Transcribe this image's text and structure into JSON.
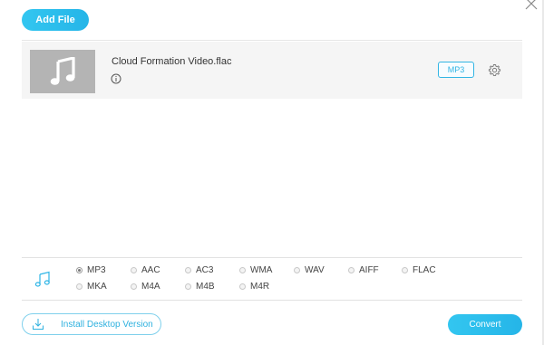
{
  "toolbar": {
    "add_file_label": "Add File"
  },
  "file": {
    "name": "Cloud Formation Video.flac",
    "output_format": "MP3"
  },
  "formats": {
    "selected": "MP3",
    "row1": [
      "MP3",
      "AAC",
      "AC3",
      "WMA",
      "WAV",
      "AIFF",
      "FLAC"
    ],
    "row2": [
      "MKA",
      "M4A",
      "M4B",
      "M4R"
    ]
  },
  "footer": {
    "install_label": "Install Desktop Version",
    "convert_label": "Convert"
  },
  "colors": {
    "accent": "#2fb5e6"
  },
  "icons": {
    "close": "close-icon",
    "thumbnail": "music-note-icon",
    "info": "info-icon",
    "settings": "gear-icon",
    "audio_formats": "music-note-icon",
    "install": "download-icon"
  }
}
